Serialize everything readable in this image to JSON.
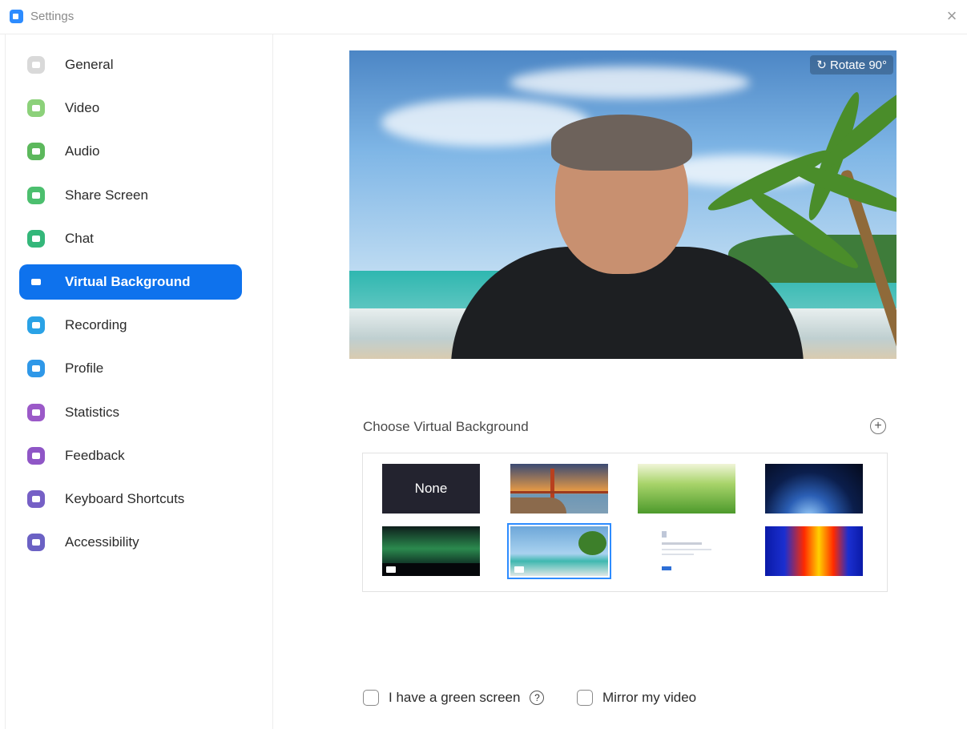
{
  "window": {
    "title": "Settings",
    "close_glyph": "×"
  },
  "sidebar": {
    "items": [
      {
        "label": "General",
        "icon": "gear-icon",
        "color": "#d9d9d9",
        "active": false
      },
      {
        "label": "Video",
        "icon": "video-camera-icon",
        "color": "#8cd17a",
        "active": false
      },
      {
        "label": "Audio",
        "icon": "headphones-icon",
        "color": "#5cb85c",
        "active": false
      },
      {
        "label": "Share Screen",
        "icon": "share-screen-icon",
        "color": "#4cbf6e",
        "active": false
      },
      {
        "label": "Chat",
        "icon": "chat-bubble-icon",
        "color": "#34b77a",
        "active": false
      },
      {
        "label": "Virtual Background",
        "icon": "person-card-icon",
        "color": "#0e72ed",
        "active": true
      },
      {
        "label": "Recording",
        "icon": "record-icon",
        "color": "#2aa2e6",
        "active": false
      },
      {
        "label": "Profile",
        "icon": "profile-icon",
        "color": "#2f98e8",
        "active": false
      },
      {
        "label": "Statistics",
        "icon": "bar-chart-icon",
        "color": "#9b59c8",
        "active": false
      },
      {
        "label": "Feedback",
        "icon": "smiley-icon",
        "color": "#8f56c6",
        "active": false
      },
      {
        "label": "Keyboard Shortcuts",
        "icon": "keyboard-icon",
        "color": "#7660c6",
        "active": false
      },
      {
        "label": "Accessibility",
        "icon": "accessibility-icon",
        "color": "#6b61c4",
        "active": false
      }
    ]
  },
  "preview": {
    "rotate_label": "Rotate 90°",
    "rotate_glyph": "↻"
  },
  "choose": {
    "label": "Choose Virtual Background",
    "add_glyph": "+",
    "thumbnails": [
      {
        "name": "thumb-none",
        "text": "None",
        "selected": false,
        "video": false
      },
      {
        "name": "thumb-golden-gate",
        "text": "",
        "selected": false,
        "video": false
      },
      {
        "name": "thumb-grass",
        "text": "",
        "selected": false,
        "video": false
      },
      {
        "name": "thumb-earth-space",
        "text": "",
        "selected": false,
        "video": false
      },
      {
        "name": "thumb-aurora",
        "text": "",
        "selected": false,
        "video": true
      },
      {
        "name": "thumb-beach",
        "text": "",
        "selected": true,
        "video": true
      },
      {
        "name": "thumb-document",
        "text": "",
        "selected": false,
        "video": false
      },
      {
        "name": "thumb-audio-wave",
        "text": "",
        "selected": false,
        "video": false
      }
    ]
  },
  "options": {
    "green_screen_label": "I have a green screen",
    "green_screen_checked": false,
    "help_glyph": "?",
    "mirror_label": "Mirror my video",
    "mirror_checked": false
  }
}
